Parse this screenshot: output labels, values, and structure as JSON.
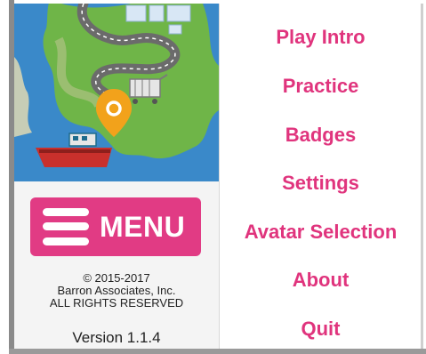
{
  "menu_button": {
    "label": "MENU",
    "icon": "hamburger-icon",
    "color": "#e13b84"
  },
  "copyright": {
    "line1": "© 2015-2017",
    "line2": "Barron Associates, Inc.",
    "line3": "ALL RIGHTS RESERVED"
  },
  "version": "Version 1.1.4",
  "menu_items": [
    {
      "label": "Play Intro"
    },
    {
      "label": "Practice"
    },
    {
      "label": "Badges"
    },
    {
      "label": "Settings"
    },
    {
      "label": "Avatar Selection"
    },
    {
      "label": "About"
    },
    {
      "label": "Quit"
    }
  ],
  "colors": {
    "accent": "#e0347d",
    "sea": "#3a89c9",
    "land": "#6fb548",
    "road": "#6b6b6b",
    "pin": "#f2a21b"
  },
  "illustration": {
    "name": "island-map-illustration",
    "icons": [
      "building-icon",
      "shopping-cart-icon",
      "location-pin-icon",
      "boat-icon"
    ]
  }
}
